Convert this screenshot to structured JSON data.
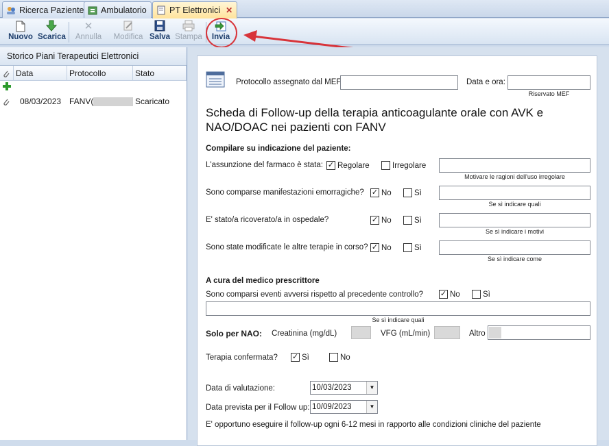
{
  "tabs": [
    {
      "label": "Ricerca Paziente",
      "icon": "people-icon"
    },
    {
      "label": "Ambulatorio",
      "icon": "ambulatory-icon"
    },
    {
      "label": "PT Elettronici",
      "icon": "document-icon",
      "close": "✕"
    }
  ],
  "toolbar": {
    "nuovo": "Nuovo",
    "scarica": "Scarica",
    "annulla": "Annulla",
    "modifica": "Modifica",
    "salva": "Salva",
    "stampa": "Stampa",
    "invia": "Invia"
  },
  "left": {
    "title": "Storico Piani Terapeutici Elettronici",
    "columns": [
      "Data",
      "Protocollo",
      "Stato"
    ],
    "rows": [
      {
        "date": "08/03/2023",
        "protocol": "FANV(",
        "status": "Scaricato"
      }
    ]
  },
  "form": {
    "mef_label": "Protocollo assegnato dal MEF",
    "datetime_label": "Data e ora:",
    "reserved_caption": "Riservato MEF",
    "title": "Scheda di Follow-up della terapia anticoagulante orale con AVK e NAO/DOAC nei pazienti con FANV",
    "patient_section": "Compilare su indicazione del paziente:",
    "q1": {
      "label": "L'assunzione del farmaco è stata:",
      "opt1": "Regolare",
      "opt2": "Irregolare",
      "caption": "Motivare le ragioni dell'uso irregolare"
    },
    "q2": {
      "label": "Sono comparse manifestazioni emorragiche?",
      "opt1": "No",
      "opt2": "Sì",
      "caption": "Se sì indicare quali"
    },
    "q3": {
      "label": "E' stato/a ricoverato/a in ospedale?",
      "opt1": "No",
      "opt2": "Sì",
      "caption": "Se sì indicare i motivi"
    },
    "q4": {
      "label": "Sono state modificate le altre terapie in corso?",
      "opt1": "No",
      "opt2": "Sì",
      "caption": "Se sì indicare come"
    },
    "doctor_section": "A cura del medico prescrittore",
    "q5": {
      "label": "Sono comparsi eventi avversi rispetto al precedente controllo?",
      "opt1": "No",
      "opt2": "Sì",
      "caption": "Se sì indicare quali"
    },
    "nao": {
      "label": "Solo per NAO:",
      "creatinina": "Creatinina (mg/dL)",
      "vfg": "VFG (mL/min)",
      "altro": "Altro"
    },
    "confirmed": {
      "label": "Terapia confermata?",
      "opt1": "Sì",
      "opt2": "No"
    },
    "eval_date_label": "Data di valutazione:",
    "eval_date": "10/03/2023",
    "followup_label": "Data prevista per il Follow up:",
    "followup_date": "10/09/2023",
    "note": "E' opportuno eseguire il follow-up ogni 6-12 mesi in rapporto alle condizioni cliniche del paziente"
  },
  "colors": {
    "highlight": "#d8343a",
    "active_tab": "#ffe39c"
  }
}
